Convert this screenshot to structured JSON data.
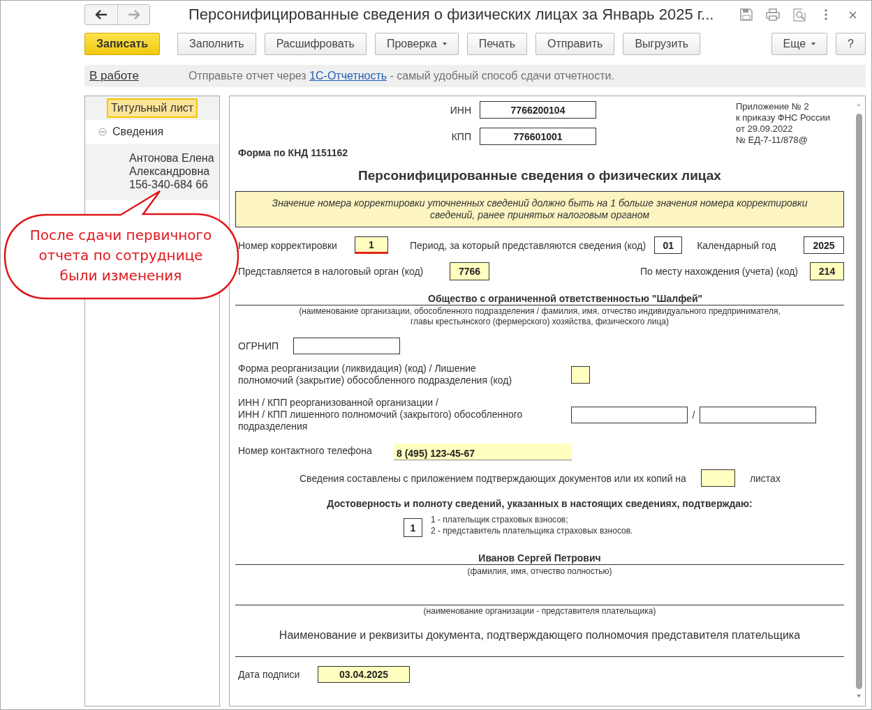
{
  "window": {
    "title": "Персонифицированные сведения о физических лицах за Январь 2025 г..."
  },
  "toolbar": {
    "buttons": [
      {
        "label": "Записать",
        "kind": "primary"
      },
      {
        "label": "Заполнить",
        "kind": "plain"
      },
      {
        "label": "Расшифровать",
        "kind": "plain"
      },
      {
        "label": "Проверка",
        "kind": "dropdown"
      },
      {
        "label": "Печать",
        "kind": "plain"
      },
      {
        "label": "Отправить",
        "kind": "plain"
      },
      {
        "label": "Выгрузить",
        "kind": "plain"
      }
    ],
    "right_buttons": [
      {
        "label": "Еще",
        "kind": "dropdown"
      },
      {
        "label": "?",
        "kind": "plain"
      }
    ]
  },
  "info_bar": {
    "status": "В работе",
    "message_before": "Отправьте отчет через",
    "link": "1С-Отчетность",
    "message_after": "- самый удобный способ сдачи отчетности."
  },
  "sidebar": {
    "items": [
      {
        "label": "Титульный лист",
        "selected": true
      },
      {
        "label": "Сведения",
        "selected": false,
        "expanded": true,
        "children": [
          {
            "label": "Антонова Елена\nАлександровна\n156-340-684 66",
            "selected": false
          }
        ]
      }
    ]
  },
  "form": {
    "inn": {
      "label": "ИНН",
      "value": "7766200104",
      "editable": false
    },
    "kpp": {
      "label": "КПП",
      "value": "776601001",
      "editable": false
    },
    "appendix_note": "Приложение № 2\nк приказу ФНС России\nот 29.09.2022\n№ ЕД-7-11/878@",
    "knd": "Форма по КНД 1151162",
    "heading": "Персонифицированные сведения о физических лицах",
    "notice": "Значение номера корректировки уточненных сведений должно быть на 1 больше значения номера корректировки сведений, ранее принятых налоговым органом",
    "correction": {
      "label": "Номер корректировки",
      "value": "1",
      "editable": true,
      "invalid": true
    },
    "period": {
      "label": "Период, за который представляются сведения (код)",
      "value": "01",
      "editable": false
    },
    "year": {
      "label": "Календарный год",
      "value": "2025",
      "editable": false
    },
    "tax_authority": {
      "label": "Представляется в налоговый орган (код)",
      "value": "7766",
      "editable": true
    },
    "location_code": {
      "label": "По месту нахождения (учета) (код)",
      "value": "214",
      "editable": true
    },
    "organization": {
      "value": "Общество с ограниченной ответственностью \"Шалфей\"",
      "caption": "(наименование организации, обособленного подразделения / фамилия, имя, отчество индивидуального предпринимателя,\nглавы крестьянского (фермерского) хозяйства, физического лица)"
    },
    "ogrnip": {
      "label": "ОГРНИП",
      "editable": false
    },
    "reorganization_form": {
      "label": "Форма реорганизации (ликвидация) (код) / Лишение\nполномочий (закрытие) обособленного подразделения (код)",
      "editable": true
    },
    "reorganized_inn_kpp": {
      "label": "ИНН / КПП реорганизованной организации /\nИНН / КПП лишенного полномочий (закрытого) обособленного\nподразделения",
      "separator": "/",
      "editable": false
    },
    "phone": {
      "label": "Номер контактного телефона",
      "value": "8 (495) 123-45-67",
      "editable": true
    },
    "attachments": {
      "label": "Сведения составлены с приложением подтверждающих документов или их копий на",
      "unit": "листах",
      "editable": true
    },
    "confirm_heading": "Достоверность и полноту сведений, указанных в настоящих сведениях, подтверждаю:",
    "signer_type": {
      "value": "1",
      "editable": false,
      "options": [
        "1 - плательщик страховых взносов;",
        "2 - представитель плательщика страховых взносов."
      ]
    },
    "signer_name": {
      "value": "Иванов Сергей Петрович",
      "caption": "(фамилия, имя, отчество полностью)"
    },
    "representative_org": {
      "caption": "(наименование организации - представителя плательщика)"
    },
    "authority_document": {
      "caption": "Наименование и реквизиты документа, подтверждающего полномочия представителя плательщика"
    },
    "signature_date": {
      "label": "Дата подписи",
      "value": "03.04.2025",
      "editable": true
    }
  },
  "callout": {
    "text": "После сдачи первичного отчета по сотруднице были изменения"
  }
}
